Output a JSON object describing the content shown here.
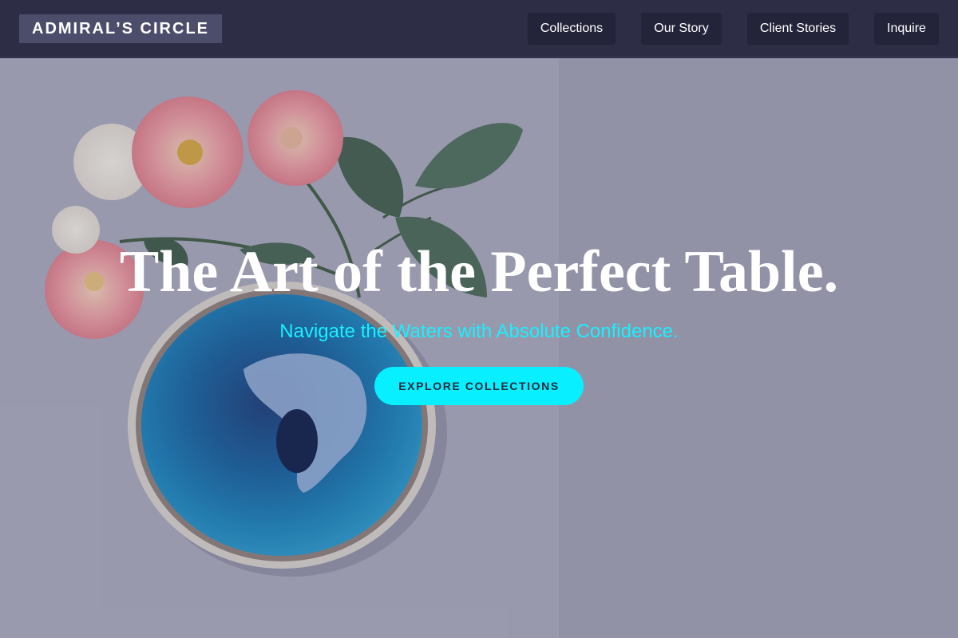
{
  "brand": "ADMIRAL’S CIRCLE",
  "nav": {
    "items": [
      "Collections",
      "Our Story",
      "Client Stories",
      "Inquire"
    ]
  },
  "hero": {
    "title": "The Art of the Perfect Table.",
    "subtitle": "Navigate the Waters with Absolute Confidence.",
    "cta_label": "EXPLORE COLLECTIONS",
    "image": "flat-lay of pink roses with green leaves beside a blue glazed ceramic bowl on a grey surface"
  },
  "colors": {
    "nav_background": "#2d2e45",
    "brand_background": "#4b4d6a",
    "nav_button_background": "#23243a",
    "accent": "#08f0ff",
    "hero_background": "#a6a7b7"
  }
}
